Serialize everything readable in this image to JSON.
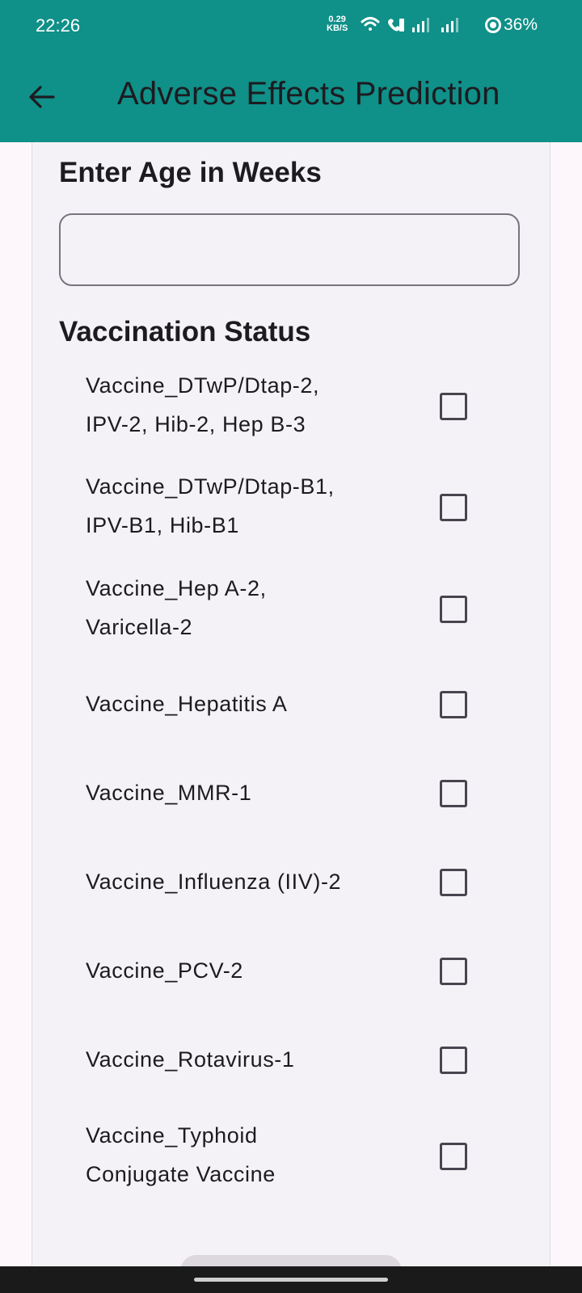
{
  "status_bar": {
    "time": "22:26",
    "net_speed_value": "0.29",
    "net_speed_unit": "KB/S",
    "battery": "36%"
  },
  "app_bar": {
    "title": "Adverse Effects Prediction",
    "color": "#0f9088"
  },
  "form": {
    "age_label": "Enter Age in Weeks",
    "age_value": "",
    "vaccination_label": "Vaccination Status",
    "vaccines": [
      {
        "label_line1": "Vaccine_DTwP/Dtap-2,",
        "label_line2": "IPV-2, Hib-2, Hep B-3",
        "checked": false
      },
      {
        "label_line1": "Vaccine_DTwP/Dtap-B1,",
        "label_line2": "IPV-B1, Hib-B1",
        "checked": false
      },
      {
        "label_line1": "Vaccine_Hep A-2,",
        "label_line2": "Varicella-2",
        "checked": false
      },
      {
        "label_line1": "Vaccine_Hepatitis A",
        "label_line2": "",
        "checked": false
      },
      {
        "label_line1": "Vaccine_MMR-1",
        "label_line2": "",
        "checked": false
      },
      {
        "label_line1": "Vaccine_Influenza (IIV)-2",
        "label_line2": "",
        "checked": false
      },
      {
        "label_line1": "Vaccine_PCV-2",
        "label_line2": "",
        "checked": false
      },
      {
        "label_line1": "Vaccine_Rotavirus-1",
        "label_line2": "",
        "checked": false
      },
      {
        "label_line1": "Vaccine_Typhoid",
        "label_line2": "Conjugate Vaccine",
        "checked": false
      }
    ]
  },
  "icons": {
    "back": "arrow-back-icon",
    "wifi": "wifi-icon",
    "call": "wifi-call-icon",
    "signal": "signal-icon",
    "battery": "battery-icon"
  }
}
